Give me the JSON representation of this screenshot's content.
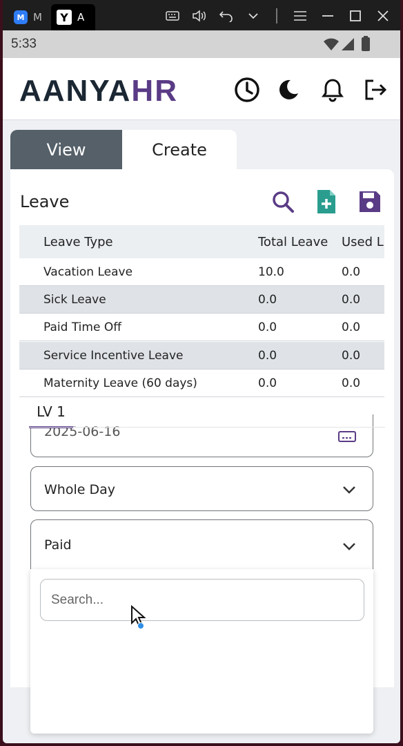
{
  "titlebar": {
    "tab1_logo": "M",
    "tab1_label": "M",
    "tab2_logo": "Y",
    "tab2_label": "A",
    "controls": [
      "keyboard-icon",
      "volume-icon",
      "undo-icon",
      "chevron-down-icon",
      "menu-icon",
      "minimize-icon",
      "maximize-icon",
      "close-icon"
    ]
  },
  "statusbar": {
    "time": "5:33"
  },
  "header": {
    "logo_part1": "AANYA",
    "logo_part2": "HR",
    "icons": [
      "clock-icon",
      "dark-mode-icon",
      "bell-icon",
      "logout-icon"
    ]
  },
  "tabs": {
    "view": "View",
    "create": "Create"
  },
  "leave_panel": {
    "title": "Leave",
    "columns": [
      "Leave Type",
      "Total Leave",
      "Used L"
    ],
    "rows": [
      [
        "Vacation Leave",
        "10.0",
        "0.0"
      ],
      [
        "Sick Leave",
        "0.0",
        "0.0"
      ],
      [
        "Paid Time Off",
        "0.0",
        "0.0"
      ],
      [
        "Service Incentive Leave",
        "0.0",
        "0.0"
      ],
      [
        "Maternity Leave (60 days)",
        "0.0",
        "0.0"
      ]
    ]
  },
  "form": {
    "subtab": "LV 1",
    "date_value": "2025-06-16",
    "day_value": "Whole Day",
    "pay_value": "Paid"
  },
  "dropdown": {
    "search_placeholder": "Search..."
  },
  "colors": {
    "brand_dark": "#1b2733",
    "brand_purple": "#5a3b86",
    "accent_teal": "#2a9d8f",
    "tab_dark": "#556069"
  }
}
